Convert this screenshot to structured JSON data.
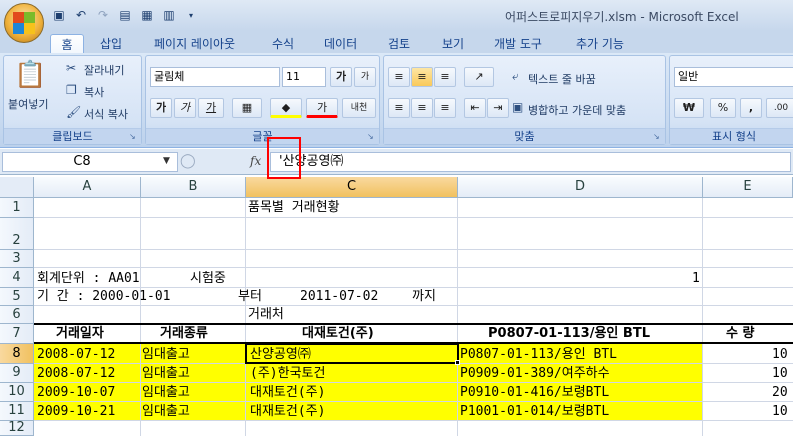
{
  "window": {
    "title": "어퍼스트로피지우기.xlsm - Microsoft Excel"
  },
  "qat": {
    "icons": [
      "save-icon",
      "undo-icon",
      "redo-icon",
      "print-preview-icon",
      "chart-icon",
      "form-icon",
      "customize-icon"
    ]
  },
  "tabs": [
    {
      "label": "홈",
      "active": true
    },
    {
      "label": "삽입"
    },
    {
      "label": "페이지 레이아웃"
    },
    {
      "label": "수식"
    },
    {
      "label": "데이터"
    },
    {
      "label": "검토"
    },
    {
      "label": "보기"
    },
    {
      "label": "개발 도구"
    },
    {
      "label": "추가 기능"
    }
  ],
  "ribbon": {
    "clipboard": {
      "label": "클립보드",
      "paste": "붙여넣기",
      "cut": "잘라내기",
      "copy": "복사",
      "format_painter": "서식 복사"
    },
    "font": {
      "label": "글꼴",
      "font_name": "굴림체",
      "font_size": "11",
      "bold": "가",
      "italic": "가",
      "underline": "가",
      "grow": "가",
      "shrink": "가",
      "phonetic": "내천"
    },
    "alignment": {
      "label": "맞춤",
      "wrap": "텍스트 줄 바꿈",
      "merge": "병합하고 가운데 맞춤"
    },
    "number": {
      "label": "표시 형식",
      "format": "일반",
      "currency": "₩",
      "percent": "%",
      "comma": ","
    }
  },
  "formula_bar": {
    "name_box": "C8",
    "fx": "fx",
    "content": "'산양공영㈜"
  },
  "columns": [
    "A",
    "B",
    "C",
    "D",
    "E"
  ],
  "rows": [
    "1",
    "2",
    "3",
    "4",
    "5",
    "6",
    "7",
    "8",
    "9",
    "10",
    "11",
    "12"
  ],
  "sheet": {
    "r1": {
      "c": "품목별 거래현황"
    },
    "r4": {
      "a": "회계단위 : AA01",
      "b": "시험중",
      "e": "1"
    },
    "r5": {
      "a": "기    간 : 2000-01-01",
      "b": "부터",
      "c": "2011-07-02",
      "d": "까지"
    },
    "r6": {
      "c": "거래처"
    },
    "header": {
      "a": "거래일자",
      "b": "거래종류",
      "c": "대재토건(주)",
      "d": "P0807-01-113/용인 BTL",
      "e": "수 량"
    },
    "data": [
      {
        "a": "2008-07-12",
        "b": "임대출고",
        "c": "산양공영㈜",
        "d": "P0807-01-113/용인 BTL",
        "e": "10"
      },
      {
        "a": "2008-07-12",
        "b": "임대출고",
        "c": "(주)한국토건",
        "d": "P0909-01-389/여주하수",
        "e": "10"
      },
      {
        "a": "2009-10-07",
        "b": "임대출고",
        "c": "대재토건(주)",
        "d": "P0910-01-416/보령BTL",
        "e": "20"
      },
      {
        "a": "2009-10-21",
        "b": "임대출고",
        "c": "대재토건(주)",
        "d": "P1001-01-014/보령BTL",
        "e": "10"
      }
    ]
  },
  "colors": {
    "highlight": "#ffff00",
    "annotation": "#ff0000",
    "selected_header": "#f1c15f"
  }
}
